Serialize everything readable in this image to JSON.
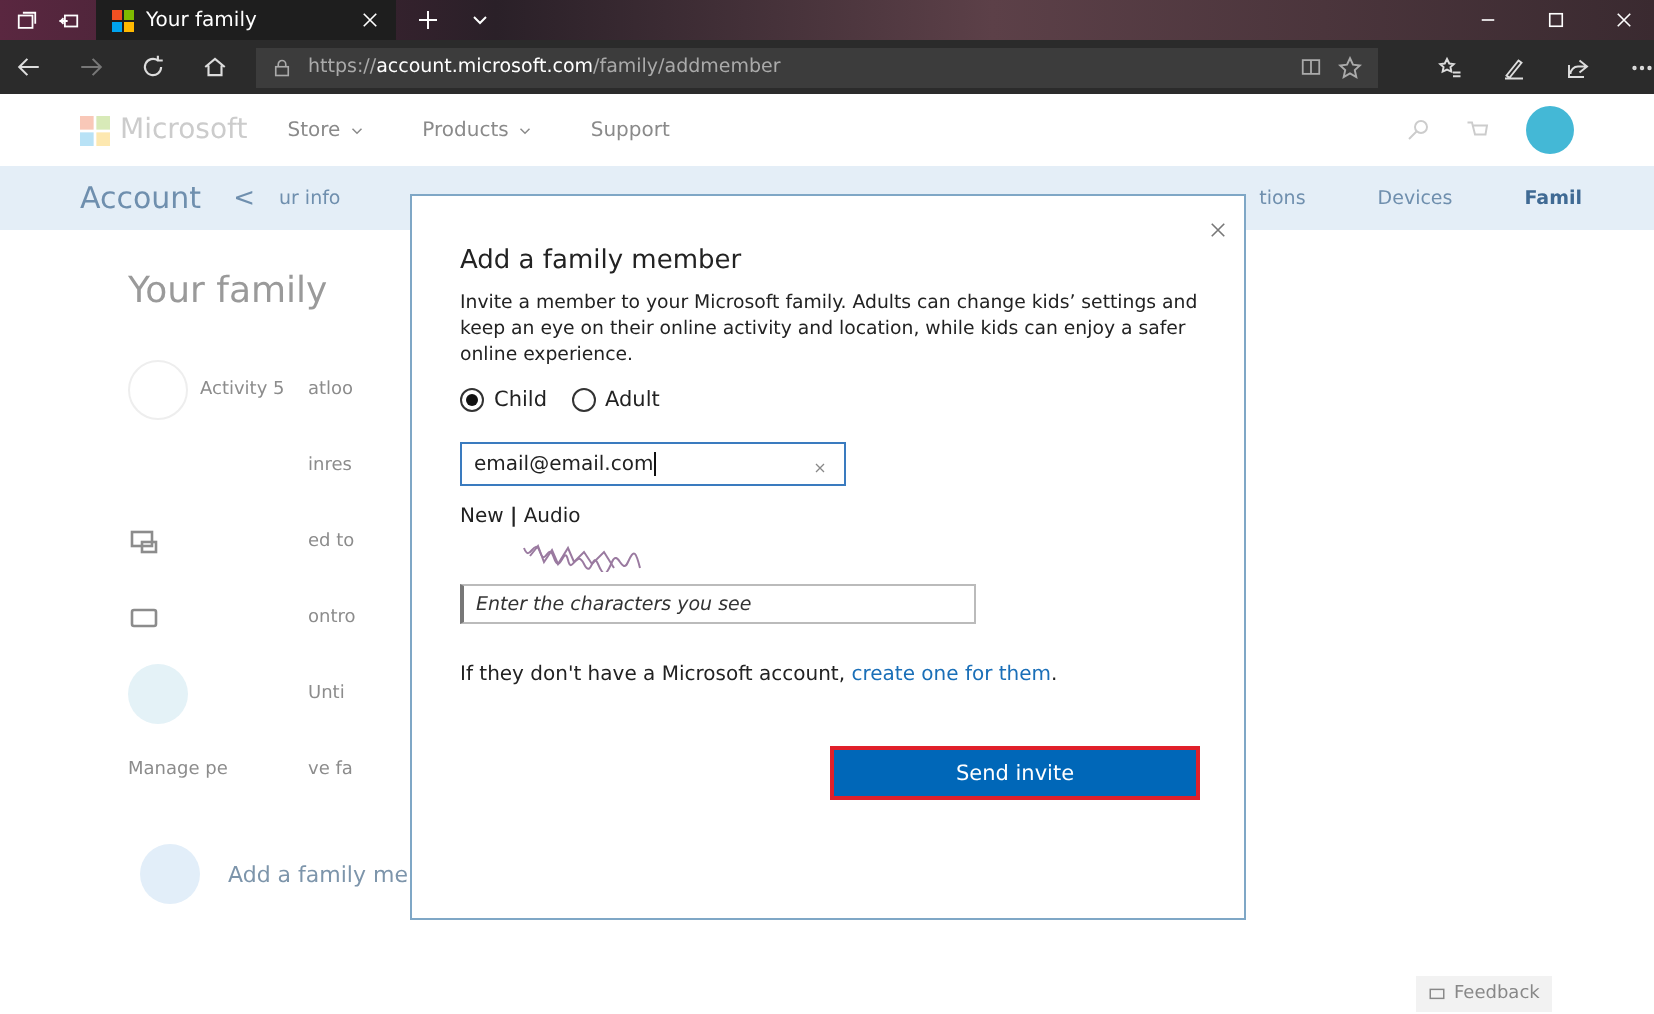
{
  "browser": {
    "tab": {
      "title": "Your family"
    },
    "url": "https://**account.microsoft.com**/family/addmember"
  },
  "site_header": {
    "brand": "Microsoft",
    "nav": [
      {
        "label": "Store",
        "dropdown": true
      },
      {
        "label": "Products",
        "dropdown": true
      },
      {
        "label": "Support",
        "dropdown": false
      }
    ]
  },
  "account_bar": {
    "title": "Account",
    "back": "<",
    "tabs": [
      {
        "label": "ur info",
        "selected": false
      },
      {
        "label": "tions",
        "selected": false
      },
      {
        "label": "Devices",
        "selected": false
      },
      {
        "label": "Famil",
        "selected": true
      }
    ]
  },
  "page": {
    "title": "Your family",
    "rows": [
      {
        "kind": "member",
        "label": "Activity",
        "value": "5",
        "column_2": "atloo"
      },
      {
        "kind": "link",
        "column_2": "inres"
      },
      {
        "kind": "device",
        "column_2": "ed to"
      },
      {
        "kind": "card",
        "column_2": "ontro"
      },
      {
        "kind": "avatar",
        "column_2": "Unti"
      },
      {
        "kind": "text",
        "label": "Manage pe",
        "column_2": "ve fa"
      }
    ],
    "add_member": "Add a family me"
  },
  "dialog": {
    "title": "Add a family member",
    "intro": "Invite a member to your Microsoft family. Adults can change kids’ settings and keep an eye on their online activity and location, while kids can enjoy a safer online experience.",
    "roles": [
      {
        "label": "Child",
        "selected": true
      },
      {
        "label": "Adult",
        "selected": false
      }
    ],
    "email": {
      "value": "email@email.com"
    },
    "captcha_options": "New **|** Audio",
    "captcha_input": {
      "placeholder": "Enter the characters you see"
    },
    "footer_text": "If they don't have a Microsoft account,",
    "footer_link": "create one for them",
    "footer_end": ".",
    "submit": "Send invite"
  },
  "feedback": "Feedback"
}
